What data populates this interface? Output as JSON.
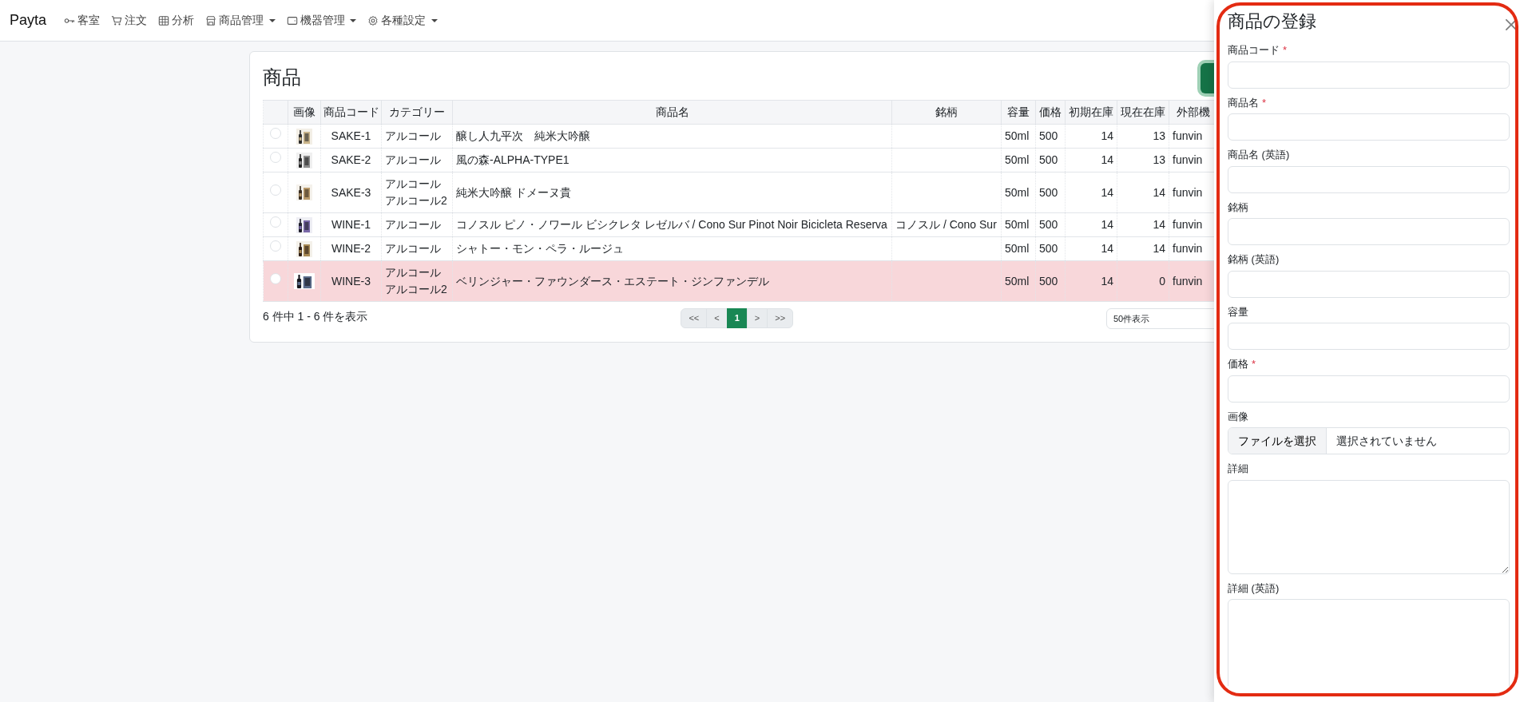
{
  "navbar": {
    "brand": "Payta",
    "items": [
      {
        "label": "客室",
        "kind": "key",
        "dropdown": false
      },
      {
        "label": "注文",
        "kind": "cart",
        "dropdown": false
      },
      {
        "label": "分析",
        "kind": "table",
        "dropdown": false
      },
      {
        "label": "商品管理",
        "kind": "shop",
        "dropdown": true
      },
      {
        "label": "機器管理",
        "kind": "wallet",
        "dropdown": true
      },
      {
        "label": "各種設定",
        "kind": "gear",
        "dropdown": true
      }
    ]
  },
  "products": {
    "title": "商品",
    "columns": [
      "画像",
      "商品コード",
      "カテゴリー",
      "商品名",
      "銘柄",
      "容量",
      "価格",
      "初期在庫",
      "現在在庫",
      "外部機"
    ],
    "rows": [
      {
        "selected": false,
        "alert": false,
        "code": "SAKE-1",
        "categories": [
          "アルコール"
        ],
        "name": "醸し人九平次　純米大吟醸",
        "brand": "",
        "volume": "50ml",
        "price": "500",
        "initial_stock": "14",
        "current_stock": "13",
        "external": "funvin"
      },
      {
        "selected": false,
        "alert": false,
        "code": "SAKE-2",
        "categories": [
          "アルコール"
        ],
        "name": "風の森-ALPHA-TYPE1",
        "brand": "",
        "volume": "50ml",
        "price": "500",
        "initial_stock": "14",
        "current_stock": "13",
        "external": "funvin"
      },
      {
        "selected": false,
        "alert": false,
        "code": "SAKE-3",
        "categories": [
          "アルコール",
          "アルコール2"
        ],
        "name": "純米大吟醸 ドメーヌ貴",
        "brand": "",
        "volume": "50ml",
        "price": "500",
        "initial_stock": "14",
        "current_stock": "14",
        "external": "funvin"
      },
      {
        "selected": false,
        "alert": false,
        "code": "WINE-1",
        "categories": [
          "アルコール"
        ],
        "name": "コノスル ピノ・ノワール ビシクレタ レゼルバ / Cono Sur Pinot Noir Bicicleta Reserva",
        "brand": "コノスル / Cono Sur",
        "volume": "50ml",
        "price": "500",
        "initial_stock": "14",
        "current_stock": "14",
        "external": "funvin"
      },
      {
        "selected": false,
        "alert": false,
        "code": "WINE-2",
        "categories": [
          "アルコール"
        ],
        "name": "シャトー・モン・ペラ・ルージュ",
        "brand": "",
        "volume": "50ml",
        "price": "500",
        "initial_stock": "14",
        "current_stock": "14",
        "external": "funvin"
      },
      {
        "selected": false,
        "alert": true,
        "code": "WINE-3",
        "categories": [
          "アルコール",
          "アルコール2"
        ],
        "name": "ベリンジャー・ファウンダース・エステート・ジンファンデル",
        "brand": "",
        "volume": "50ml",
        "price": "500",
        "initial_stock": "14",
        "current_stock": "0",
        "external": "funvin"
      }
    ],
    "summary": "6 件中 1 - 6 件を表示",
    "pagination": [
      {
        "label": "<<",
        "selected": false
      },
      {
        "label": "<",
        "selected": false
      },
      {
        "label": "1",
        "selected": true
      },
      {
        "label": ">",
        "selected": false
      },
      {
        "label": ">>",
        "selected": false
      }
    ],
    "page_size": "50件表示"
  },
  "offcanvas": {
    "title": "商品の登録",
    "highlight_frame": true,
    "fields": [
      {
        "kind": "text",
        "label": "商品コード",
        "required_mark": "*"
      },
      {
        "kind": "text",
        "label": "商品名",
        "required_mark": "*"
      },
      {
        "kind": "text",
        "label": "商品名 (英語)"
      },
      {
        "kind": "text",
        "label": "銘柄"
      },
      {
        "kind": "text",
        "label": "銘柄 (英語)"
      },
      {
        "kind": "text",
        "label": "容量"
      },
      {
        "kind": "text",
        "label": "価格",
        "required_mark": "*"
      },
      {
        "kind": "file",
        "label": "画像",
        "button": "ファイルを選択",
        "status": "選択されていません"
      },
      {
        "kind": "textarea",
        "label": "詳細"
      },
      {
        "kind": "textarea",
        "label": "詳細 (英語)"
      }
    ]
  }
}
